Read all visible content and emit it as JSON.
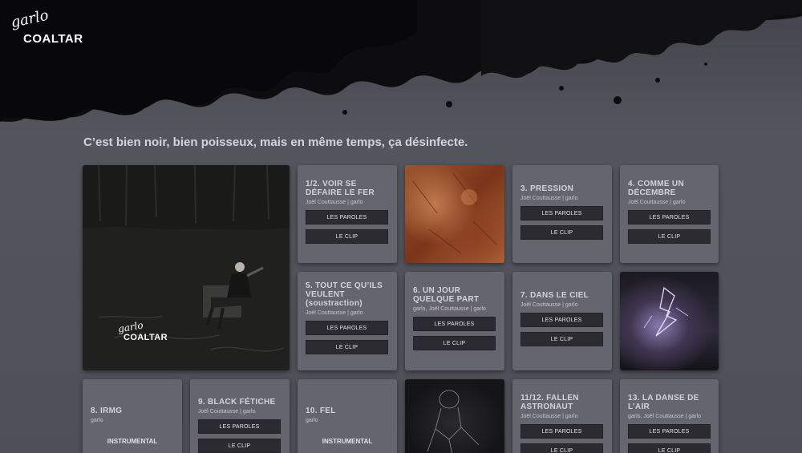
{
  "header": {
    "logo_script": "garlo",
    "logo_main": "COALTAR"
  },
  "tagline": "C’est bien noir, bien poisseux, mais en même temps, ça désinfecte.",
  "cover": {
    "script": "garlo",
    "title": "COALTAR"
  },
  "buttons": {
    "lyrics": "LES PAROLES",
    "clip": "LE CLIP"
  },
  "tracks": [
    {
      "title": "1/2. VOIR SE DÉFAIRE LE FER",
      "credit": "Joël Couttausse | garlo"
    },
    {
      "title": "3. PRESSION",
      "credit": "Joël Couttausse | garlo"
    },
    {
      "title": "4. COMME UN DÉCEMBRE",
      "credit": "Joël Couttausse | garlo"
    },
    {
      "title": "5. TOUT CE QU’ILS VEULENT (soustraction)",
      "credit": "Joël Couttausse | garlo"
    },
    {
      "title": "6. UN JOUR QUELQUE PART",
      "credit": "garlo, Joël Couttausse | garlo"
    },
    {
      "title": "7. DANS LE CIEL",
      "credit": "Joël Couttausse | garlo"
    },
    {
      "title": "8. IRMG",
      "credit": "garlo",
      "instrumental": "INSTRUMENTAL"
    },
    {
      "title": "9. BLACK FÉTICHE",
      "credit": "Joël Couttausse | garlo"
    },
    {
      "title": "10. FEL",
      "credit": "garlo",
      "instrumental": "INSTRUMENTAL"
    },
    {
      "title": "11/12. FALLEN ASTRONAUT",
      "credit": "Joël Couttausse | garlo"
    },
    {
      "title": "13. LA DANSE DE L’AIR",
      "credit": "garlo, Joël Couttausse | garlo"
    }
  ]
}
